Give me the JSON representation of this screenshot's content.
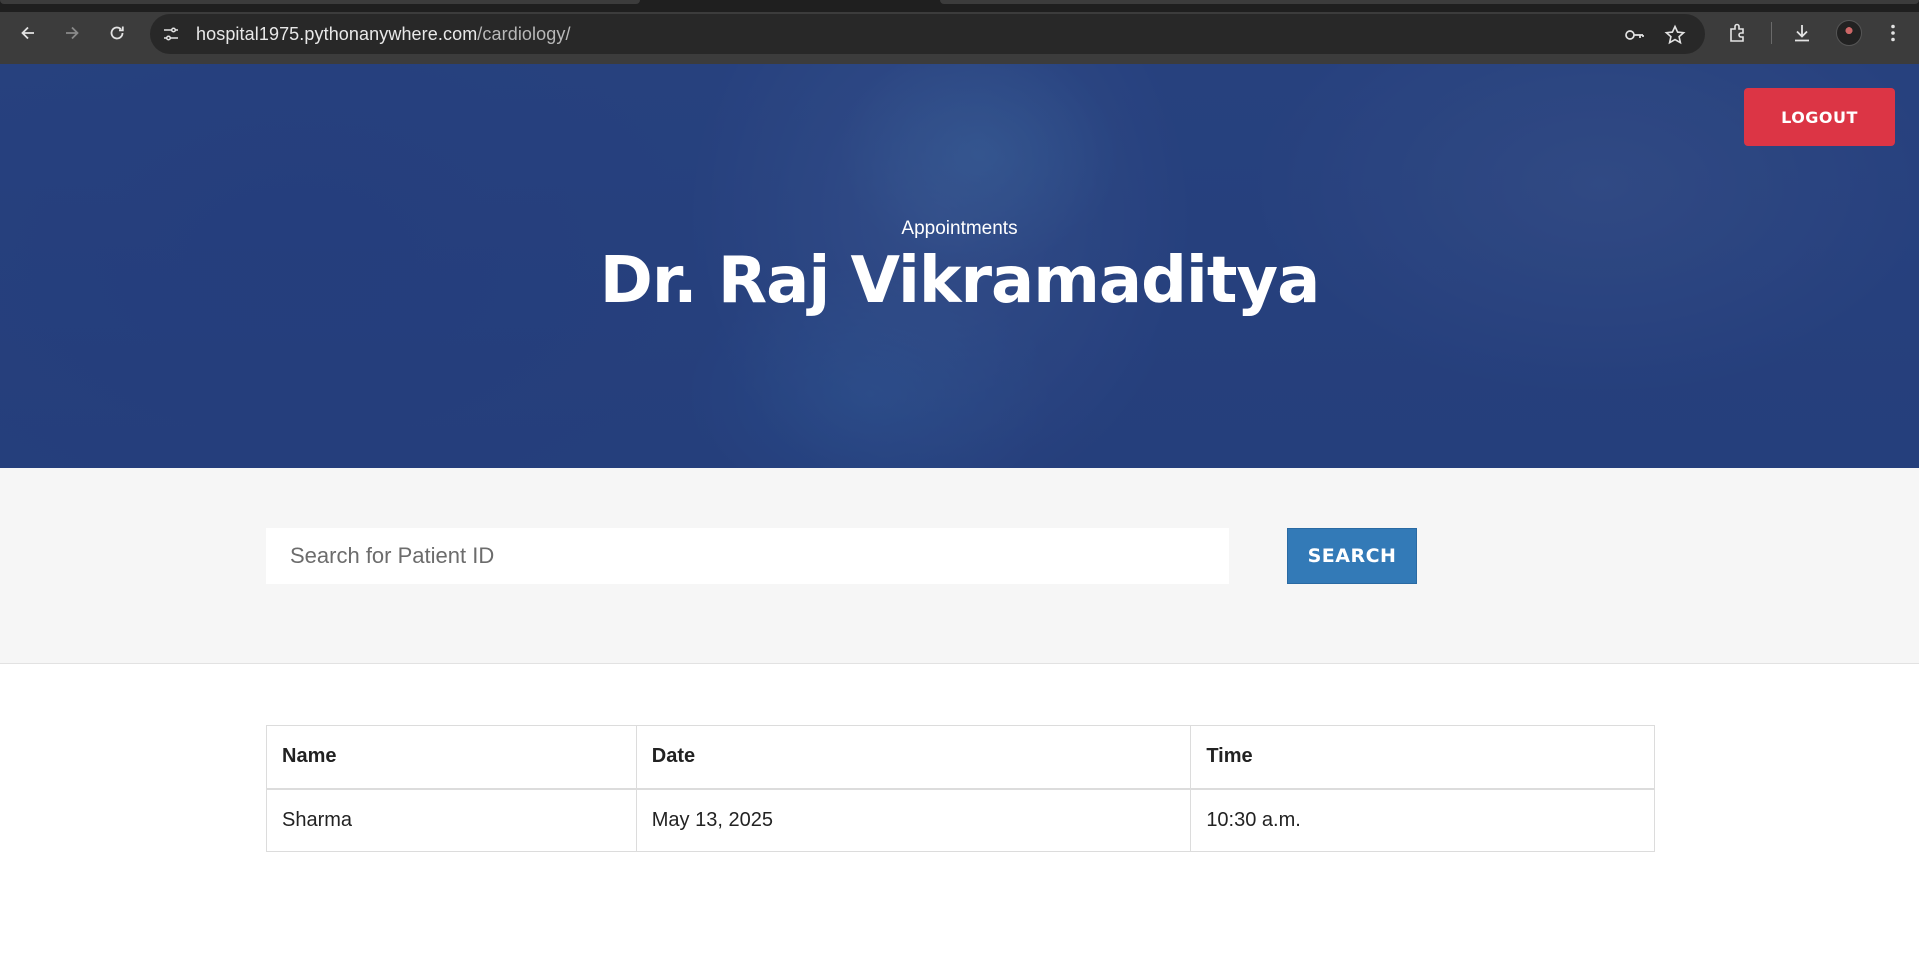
{
  "browser": {
    "url_host": "hospital1975.pythonanywhere.com",
    "url_path": "/cardiology/"
  },
  "hero": {
    "subtitle": "Appointments",
    "title": "Dr. Raj Vikramaditya",
    "logout_label": "LOGOUT",
    "logout_color": "#dc3545"
  },
  "search": {
    "placeholder": "Search for Patient ID",
    "value": "",
    "button_label": "SEARCH",
    "button_color": "#337ab7"
  },
  "table": {
    "headers": [
      "Name",
      "Date",
      "Time"
    ],
    "rows": [
      [
        "Sharma",
        "May 13, 2025",
        "10:30 a.m."
      ]
    ]
  }
}
